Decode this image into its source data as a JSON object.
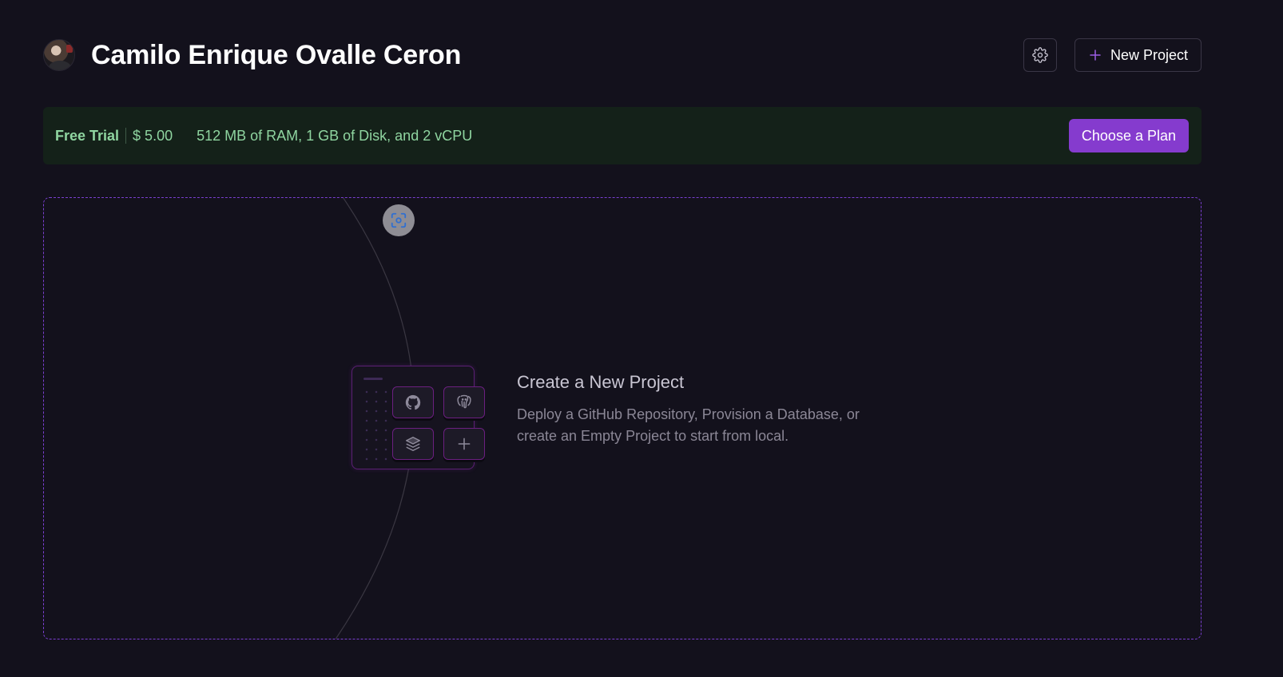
{
  "header": {
    "user_name": "Camilo Enrique Ovalle Ceron",
    "avatar_icon": "user-avatar",
    "settings_icon": "gear-icon",
    "new_project_label": "New Project",
    "new_project_icon": "plus-icon"
  },
  "trial": {
    "label": "Free Trial",
    "amount": "$ 5.00",
    "resources": "512 MB of RAM, 1 GB of Disk, and 2 vCPU",
    "choose_plan_label": "Choose a Plan"
  },
  "empty_state": {
    "title": "Create a New Project",
    "description": "Deploy a GitHub Repository, Provision a Database, or create an Empty Project to start from local.",
    "focus_icon": "focus-scan-icon",
    "tiles": [
      "github-icon",
      "postgres-icon",
      "stack-icon",
      "plus-icon"
    ]
  },
  "colors": {
    "background": "#13111c",
    "accent": "#853bce",
    "trial_bg": "#142119",
    "trial_text": "#8fd5a0"
  }
}
